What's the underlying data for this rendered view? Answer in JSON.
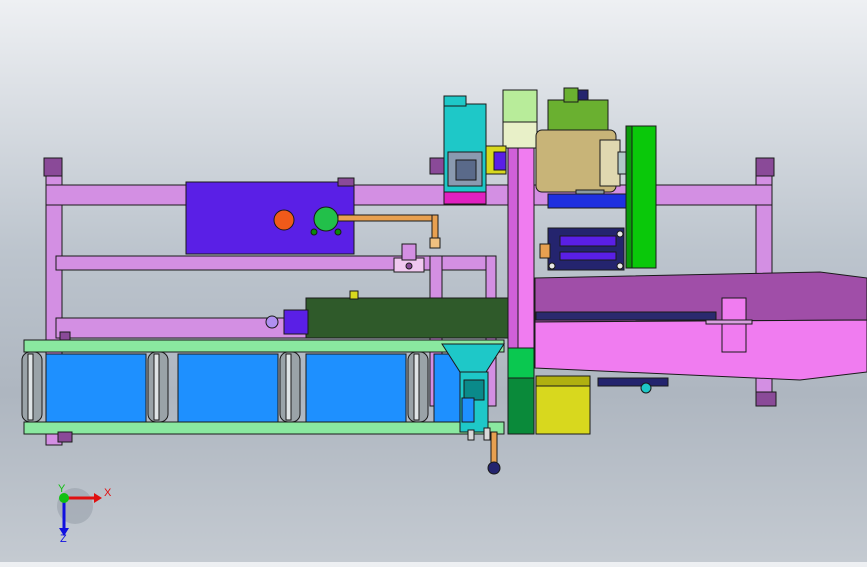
{
  "scene": {
    "palette": {
      "frame": "#d38fe3",
      "frame_dark": "#8a4a98",
      "cylinder_blue": "#5a1fe6",
      "knob_orange": "#f05a1a",
      "knob_green": "#22c04a",
      "dark_green": "#2f5a2a",
      "conveyor_blue": "#1e90ff",
      "roller_gray": "#9aa3a8",
      "pink_tube": "#f07cf0",
      "tube_dark": "#a04ea8",
      "motor_tan": "#c8b478",
      "gearbox_green": "#6ab030",
      "belt_guard_green": "#0ac80a",
      "cyan_box": "#1ec8c8",
      "yellow_box": "#d8d81e",
      "navy": "#24246e",
      "light_green_pipe": "#b8ec9a"
    }
  },
  "triad": {
    "x_label": "X",
    "y_label": "Y",
    "z_label": "Z",
    "x_color": "#e01010",
    "y_color": "#10c010",
    "z_color": "#1010e0"
  }
}
